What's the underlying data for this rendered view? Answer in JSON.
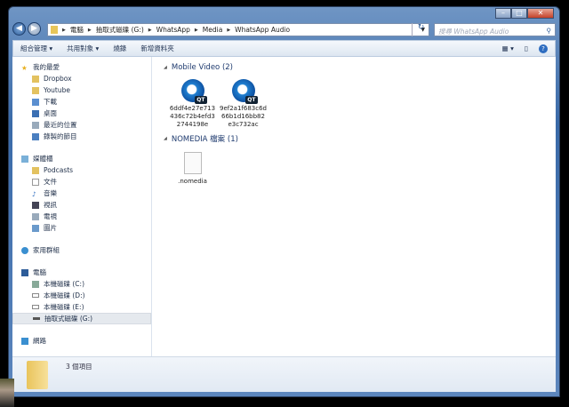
{
  "window": {
    "controls": [
      "minimize",
      "maximize",
      "close"
    ]
  },
  "address": {
    "crumbs": [
      "電腦",
      "抽取式磁碟 (G:)",
      "WhatsApp",
      "Media",
      "WhatsApp Audio"
    ]
  },
  "search": {
    "placeholder": "搜尋 WhatsApp Audio"
  },
  "toolbar": {
    "organize": "組合管理 ▾",
    "share": "共用對象 ▾",
    "burn": "燒錄",
    "new_folder": "新增資料夾"
  },
  "sidebar": {
    "favorites": {
      "label": "我的最愛",
      "items": [
        "Dropbox",
        "Youtube",
        "下載",
        "桌面",
        "最近的位置",
        "錄製的節目"
      ]
    },
    "libraries": {
      "label": "媒體櫃",
      "items": [
        "Podcasts",
        "文件",
        "音樂",
        "視訊",
        "電視",
        "圖片"
      ]
    },
    "homegroup": {
      "label": "家用群組"
    },
    "computer": {
      "label": "電腦",
      "items": [
        "本機磁碟 (C:)",
        "本機磁碟 (D:)",
        "本機磁碟 (E:)",
        "抽取式磁碟 (G:)"
      ]
    },
    "network": {
      "label": "網路"
    }
  },
  "groups": [
    {
      "title": "Mobile Video (2)",
      "files": [
        "6ddf4e27e713436c72b4efd32744198e",
        "9ef2a1f683c6d66b1d16bb82e3c732ac"
      ]
    },
    {
      "title": "NOMEDIA 檔案 (1)",
      "files": [
        ".nomedia"
      ]
    }
  ],
  "status": {
    "count": "3 個項目"
  }
}
